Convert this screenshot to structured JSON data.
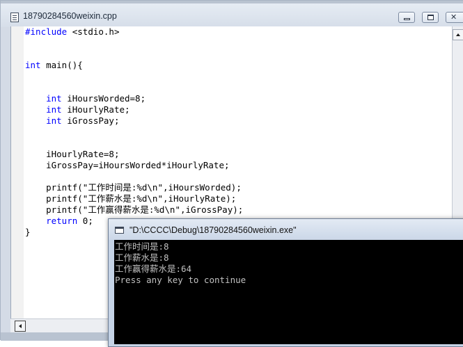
{
  "editor": {
    "title": "18790284560weixin.cpp",
    "code_lines": [
      {
        "kw": "#include",
        "text": " <stdio.h>"
      },
      {
        "kw": "",
        "text": ""
      },
      {
        "kw": "",
        "text": ""
      },
      {
        "kw": "int",
        "text": " main(){"
      },
      {
        "kw": "",
        "text": ""
      },
      {
        "kw": "",
        "text": ""
      },
      {
        "indent": "    ",
        "kw": "int",
        "text": " iHoursWorded=8;"
      },
      {
        "indent": "    ",
        "kw": "int",
        "text": " iHourlyRate;"
      },
      {
        "indent": "    ",
        "kw": "int",
        "text": " iGrossPay;"
      },
      {
        "kw": "",
        "text": ""
      },
      {
        "kw": "",
        "text": ""
      },
      {
        "indent": "    ",
        "kw": "",
        "text": "iHourlyRate=8;"
      },
      {
        "indent": "    ",
        "kw": "",
        "text": "iGrossPay=iHoursWorded*iHourlyRate;"
      },
      {
        "kw": "",
        "text": ""
      },
      {
        "indent": "    ",
        "kw": "",
        "text": "printf(\"工作时间是:%d\\n\",iHoursWorded);"
      },
      {
        "indent": "    ",
        "kw": "",
        "text": "printf(\"工作薪水是:%d\\n\",iHourlyRate);"
      },
      {
        "indent": "    ",
        "kw": "",
        "text": "printf(\"工作赢得薪水是:%d\\n\",iGrossPay);"
      },
      {
        "indent": "    ",
        "kw": "return",
        "text": " 0;"
      },
      {
        "kw": "",
        "text": "}"
      }
    ]
  },
  "console": {
    "title": "\"D:\\CCCC\\Debug\\18790284560weixin.exe\"",
    "lines": [
      "工作时间是:8",
      "工作薪水是:8",
      "工作赢得薪水是:64",
      "Press any key to continue"
    ]
  },
  "colors": {
    "keyword": "#0000ff",
    "console_bg": "#000000",
    "console_text": "#c0c0c0"
  }
}
